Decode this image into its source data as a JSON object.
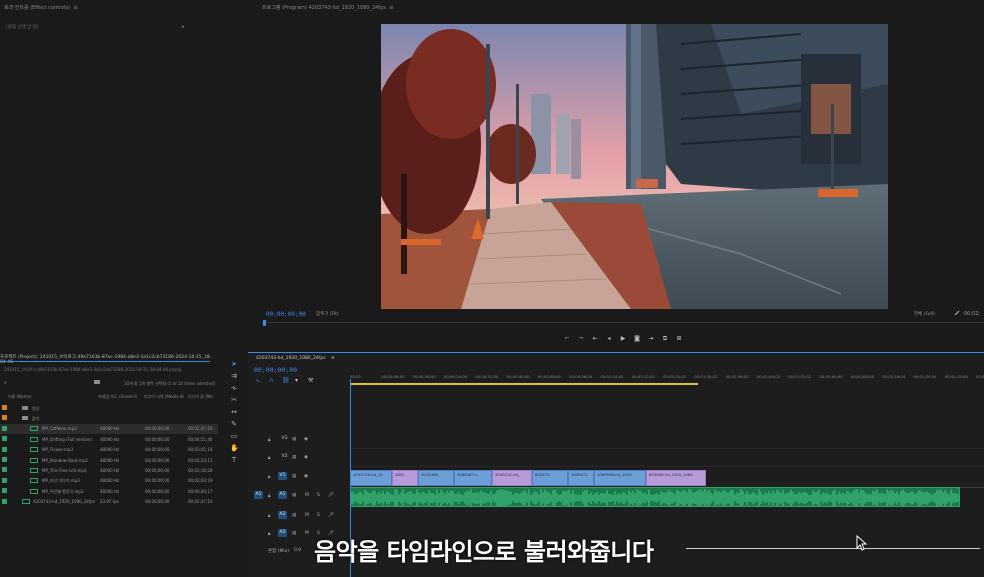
{
  "effect_controls": {
    "title": "효과 컨트롤 (Effect controls)",
    "menu_icon": "≡",
    "subtitle": "(클립 선택 안 됨)",
    "arrow": "▸"
  },
  "program_monitor": {
    "title": "프로그램 (Program) 4203743-hd_1920_1080_24fps",
    "menu_icon": "≡",
    "timecode_current": "00;00;00;00",
    "fit_label": "맞추기 (Fit)",
    "quality_label": "전체 (Full)",
    "timecode_end": "00;02;"
  },
  "project_panel": {
    "tab_label": "프로젝트 (Project): 241015_브이로그-49a7103b-87ec-1984-a8e3-3a1c2cb73186-2024-10-15_18-04-46",
    "path": "241015_브이로그-49a7103b-87ec-1984-a8e3-3a1c2cb73186-2024-10-15_18-04-46.prproj",
    "search_icon": "⌕",
    "item_count": "10개 중 1개 항목 선택됨 (1 of 10 items selected)",
    "columns": {
      "name": "이름 (Name)",
      "rate": "프레임 속도 (Frame R",
      "start": "미디어 시작 (Media St",
      "end": "미디어 끝 (Me"
    },
    "rows": [
      {
        "name": "영상",
        "rate": "",
        "start": "",
        "end": "",
        "chip": "#e07b2a",
        "type": "folder"
      },
      {
        "name": "음악",
        "rate": "",
        "start": "",
        "end": "",
        "chip": "#e07b2a",
        "type": "folder"
      },
      {
        "name": "MP_Caffeine.mp3",
        "rate": "48000 Hz",
        "start": "00;00;00;00",
        "end": "00;02;47;10",
        "chip": "#2fa36a",
        "type": "audio",
        "selected": true
      },
      {
        "name": "MP_Drifting (Full Version)",
        "rate": "48000 Hz",
        "start": "00;00;00;00",
        "end": "00;04;51;46",
        "chip": "#2fa36a",
        "type": "audio"
      },
      {
        "name": "MP_Flower.mp3",
        "rate": "48000 Hz",
        "start": "00;00;00;00",
        "end": "00;03;01;14",
        "chip": "#2fa36a",
        "type": "audio"
      },
      {
        "name": "MP_Rainbow Boat.mp3",
        "rate": "48000 Hz",
        "start": "00;00;00;00",
        "end": "00;03;33;11",
        "chip": "#2fa36a",
        "type": "audio"
      },
      {
        "name": "MP_This Free Life.mp3",
        "rate": "48000 Hz",
        "start": "00;00;00;00",
        "end": "00;03;16;28",
        "chip": "#2fa36a",
        "type": "audio"
      },
      {
        "name": "MP_조선 이야기.mp3",
        "rate": "48000 Hz",
        "start": "00;00;00;00",
        "end": "00;02;03;19",
        "chip": "#2fa36a",
        "type": "audio"
      },
      {
        "name": "MP_어린별 행진곡.mp3",
        "rate": "48000 Hz",
        "start": "00;00;00;00",
        "end": "00;00;40;17",
        "chip": "#2fa36a",
        "type": "audio"
      },
      {
        "name": "4203743-hd_1920_1080_24fps",
        "rate": "23.97 fps",
        "start": "00;00;00;00",
        "end": "00;02;47;10",
        "chip": "#2fa36a",
        "type": "sequence"
      }
    ]
  },
  "timeline": {
    "title": "4203743-hd_1920_1080_24fps",
    "menu_icon": "≡",
    "timecode": "00;00;00;00",
    "ruler_ticks": [
      "00;00",
      "00;00;08;00",
      "00;00;16;00",
      "00;00;24;00",
      "00;00;32;00",
      "00;00;40;00",
      "00;00;48;00",
      "00;00;56;00",
      "00;01;04;02",
      "00;01;12;02",
      "00;01;20;02",
      "00;01;28;02",
      "00;01;36;02",
      "00;01;44;02",
      "00;01;52;02",
      "00;02;00;04",
      "00;02;08;04",
      "00;02;16;04",
      "00;02;24;04",
      "00;02;32;04",
      "00;02;40;04"
    ],
    "tracks": {
      "v3": "V3",
      "v2": "V2",
      "v1": "V1",
      "a1": "A1",
      "a2": "A2",
      "a3": "A3",
      "mix_label": "혼합 (Mix)",
      "mix_value": "0.0"
    },
    "video_clips": [
      {
        "label": "4203743-hd_19",
        "color": "blue"
      },
      {
        "label": "2801",
        "color": "pink"
      },
      {
        "label": "3015486",
        "color": "blue"
      },
      {
        "label": "3066487-u",
        "color": "blue"
      },
      {
        "label": "4546211-hd_",
        "color": "pink"
      },
      {
        "label": "855574-",
        "color": "blue"
      },
      {
        "label": "1906472",
        "color": "blue"
      },
      {
        "label": "2069568-hd_1920",
        "color": "blue"
      },
      {
        "label": "853958-hd_1920_1080",
        "color": "pink"
      }
    ]
  },
  "subtitle": "음악을 타임라인으로 불러와줍니다",
  "colors": {
    "accent_blue": "#3a8be8",
    "audio_green": "#1a7a4b",
    "video_blue": "#6e9ed6",
    "video_pink": "#b79bd8",
    "workarea_yellow": "#d7c340"
  }
}
